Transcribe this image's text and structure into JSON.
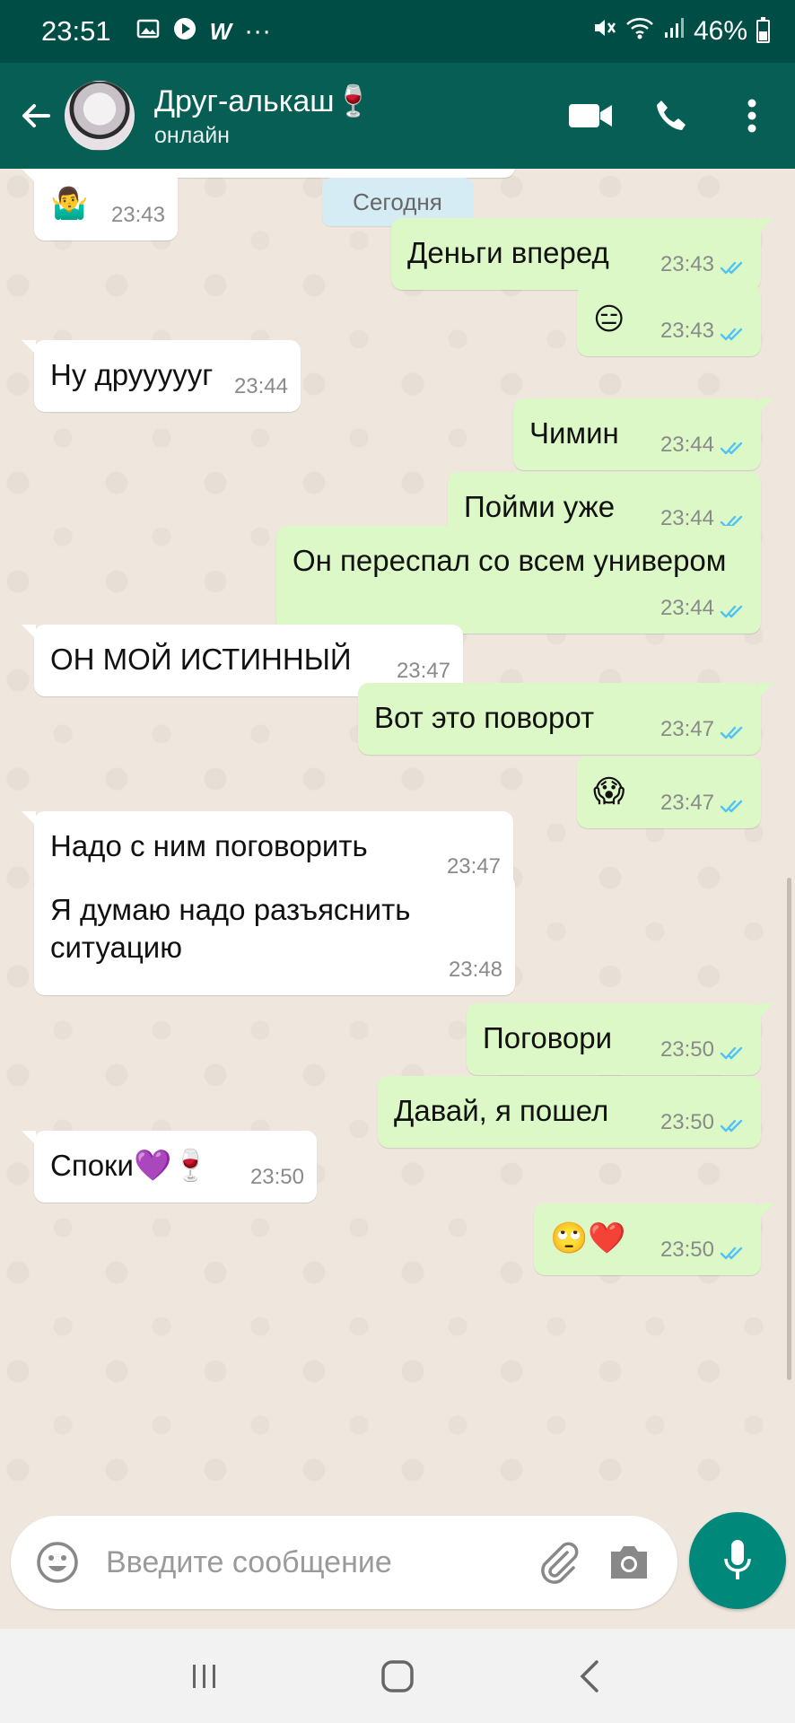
{
  "status_bar": {
    "time": "23:51",
    "battery": "46%",
    "more": "···"
  },
  "header": {
    "name": "Друг-алькаш",
    "name_emoji": "🍷",
    "status": "онлайн"
  },
  "date_chip": "Сегодня",
  "messages": [
    {
      "dir": "in",
      "text": "",
      "emoji": "🤷‍♂️",
      "time": "23:43"
    },
    {
      "dir": "out",
      "text": "Деньги вперед",
      "emoji": "",
      "time": "23:43"
    },
    {
      "dir": "out",
      "text": "",
      "emoji": "😑",
      "time": "23:43"
    },
    {
      "dir": "in",
      "text": "Ну друууууг",
      "emoji": "",
      "time": "23:44"
    },
    {
      "dir": "out",
      "text": "Чимин",
      "emoji": "",
      "time": "23:44"
    },
    {
      "dir": "out",
      "text": "Пойми уже",
      "emoji": "",
      "time": "23:44"
    },
    {
      "dir": "out",
      "text": "Он переспал со всем универом",
      "emoji": "",
      "time": "23:44"
    },
    {
      "dir": "in",
      "text": "ОН МОЙ ИСТИННЫЙ",
      "emoji": "",
      "time": "23:47"
    },
    {
      "dir": "out",
      "text": "Вот это поворот",
      "emoji": "",
      "time": "23:47"
    },
    {
      "dir": "out",
      "text": "",
      "emoji": "😱",
      "time": "23:47"
    },
    {
      "dir": "in",
      "text": "Надо с ним поговорить",
      "emoji": "",
      "time": "23:47"
    },
    {
      "dir": "in",
      "text": "Я думаю надо разъяснить ситуацию",
      "emoji": "",
      "time": "23:48"
    },
    {
      "dir": "out",
      "text": "Поговори",
      "emoji": "",
      "time": "23:50"
    },
    {
      "dir": "out",
      "text": "Давай, я пошел",
      "emoji": "",
      "time": "23:50"
    },
    {
      "dir": "in",
      "text": "Споки",
      "emoji": "💜🍷",
      "time": "23:50"
    },
    {
      "dir": "out",
      "text": "",
      "emoji": "🙄❤️",
      "time": "23:50"
    }
  ],
  "input": {
    "placeholder": "Введите сообщение"
  },
  "colors": {
    "header": "#075e54",
    "statusbar": "#004d46",
    "outgoing": "#dcf8c6",
    "incoming": "#ffffff",
    "tick": "#4fc3f7",
    "mic": "#00897b"
  }
}
